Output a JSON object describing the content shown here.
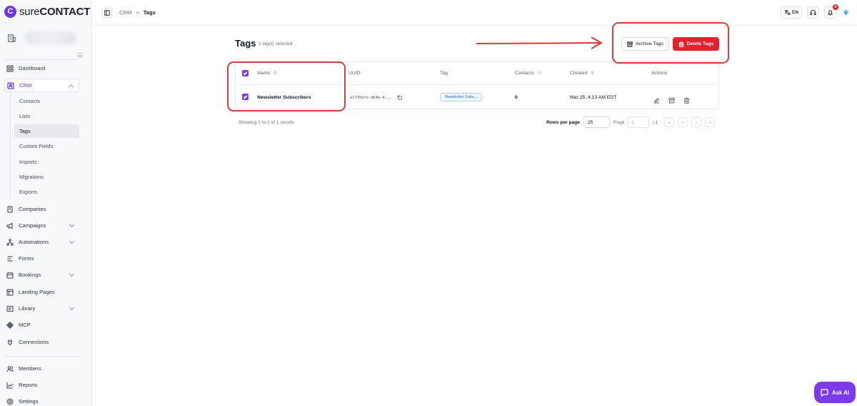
{
  "brand": {
    "logo_letter": "C",
    "name_light": "sure",
    "name_bold": "CONTACT",
    "accent": "#6d37e8"
  },
  "sidebar": {
    "items": [
      {
        "label": "Dashboard",
        "icon": "dashboard-icon"
      },
      {
        "label": "CRM",
        "icon": "crm-icon",
        "expanded": true
      },
      {
        "label": "Companies",
        "icon": "building-icon"
      },
      {
        "label": "Campaigns",
        "icon": "megaphone-icon"
      },
      {
        "label": "Automations",
        "icon": "automation-icon"
      },
      {
        "label": "Forms",
        "icon": "forms-icon"
      },
      {
        "label": "Bookings",
        "icon": "calendar-icon"
      },
      {
        "label": "Landing Pages",
        "icon": "layout-icon"
      },
      {
        "label": "Library",
        "icon": "library-icon"
      },
      {
        "label": "MCP",
        "icon": "mcp-icon"
      },
      {
        "label": "Connections",
        "icon": "plug-icon"
      }
    ],
    "crm_sub": [
      "Contacts",
      "Lists",
      "Tags",
      "Custom Fields",
      "Imports",
      "Migrations",
      "Exports"
    ],
    "bottom": [
      {
        "label": "Members",
        "icon": "users-icon"
      },
      {
        "label": "Reports",
        "icon": "chart-icon"
      },
      {
        "label": "Settings",
        "icon": "gear-icon"
      }
    ]
  },
  "topbar": {
    "breadcrumb": [
      "CRM",
      "Tags"
    ],
    "lang": "EN",
    "notification_count": "6"
  },
  "main": {
    "title": "Tags",
    "subtitle": "1 tag(s) selected",
    "archive_label": "Archive Tags",
    "delete_label": "Delete Tags",
    "delete_color": "#e5202f",
    "columns": [
      "Name",
      "UUID",
      "Tag",
      "Contacts",
      "Created",
      "Actions"
    ],
    "rows": [
      {
        "name": "Newsletter Subscribers",
        "uuid": "ec735bfe-064b-4...",
        "tag": "Newsletter Subs...",
        "contacts": "0",
        "created": "Mar 25, 4:13 AM EDT"
      }
    ],
    "showing": "Showing 1 to 1 of 1 results",
    "rows_per_page_label": "Rows per page",
    "rows_per_page": "25",
    "page_label": "Page",
    "page_value": "1",
    "page_of": "/ 1",
    "pager_buttons": [
      "«",
      "‹",
      "›",
      "»"
    ]
  },
  "ask_ai": "Ask AI",
  "annotation_color": "#d83b3b"
}
